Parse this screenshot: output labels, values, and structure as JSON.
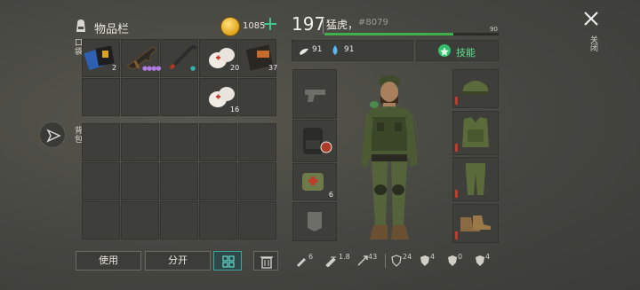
{
  "inventory": {
    "title": "物品栏",
    "coins": "1085",
    "add_label": "+",
    "pocket_label": "口袋",
    "backpack_label": "背包",
    "pocket_items": [
      {
        "slot": 0,
        "name": "passport",
        "qty": "2"
      },
      {
        "slot": 1,
        "name": "assault-rifle",
        "qty": ""
      },
      {
        "slot": 2,
        "name": "crowbar",
        "qty": ""
      },
      {
        "slot": 3,
        "name": "bandage",
        "qty": "20"
      },
      {
        "slot": 4,
        "name": "notebook",
        "qty": "37"
      },
      {
        "slot": 8,
        "name": "bandage",
        "qty": "16"
      }
    ],
    "use_label": "使用",
    "split_label": "分开"
  },
  "character": {
    "level": "197",
    "name": "猛虎，",
    "id": "#8079",
    "xp_max": "90",
    "xp_fraction": 0.74,
    "hunger": "91",
    "thirst": "91",
    "skills_label": "技能",
    "weapon_slots": [
      {
        "name": "pistol-slot",
        "qty": ""
      },
      {
        "name": "backpack-slot",
        "qty": ""
      },
      {
        "name": "medkit-bag-slot",
        "qty": "6"
      },
      {
        "name": "pocket-slot",
        "qty": ""
      }
    ],
    "armor_slots": [
      "helmet",
      "armor-vest",
      "pants",
      "boots"
    ]
  },
  "stats": [
    {
      "name": "attack",
      "value": "6"
    },
    {
      "name": "attack-speed",
      "value": "1.8"
    },
    {
      "name": "accuracy",
      "value": "43"
    },
    {
      "name": "defense",
      "value": "24"
    },
    {
      "name": "cut-resist",
      "value": "4"
    },
    {
      "name": "bite-resist",
      "value": "0"
    },
    {
      "name": "crush-resist",
      "value": "4"
    }
  ],
  "close_label": "关闭",
  "colors": {
    "accent_green": "#3fb04a",
    "teal": "#3fa4a0",
    "gold": "#e0a21b"
  }
}
